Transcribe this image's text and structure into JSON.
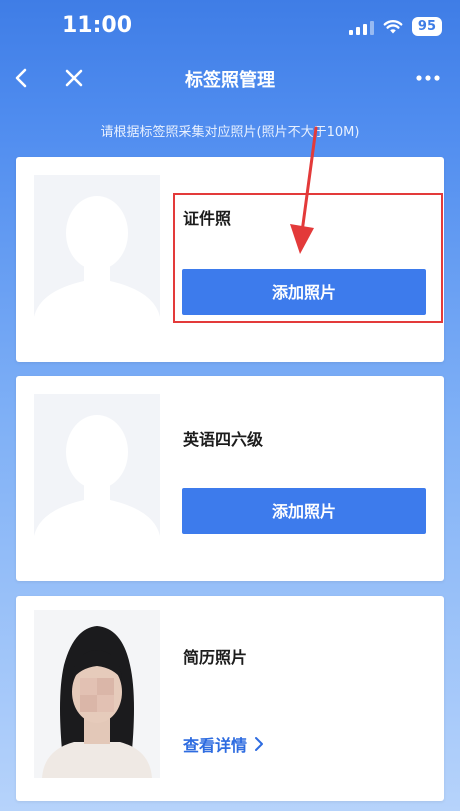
{
  "status_bar": {
    "time": "11:00",
    "battery": "95"
  },
  "nav": {
    "title": "标签照管理",
    "back_icon": "chevron-left-icon",
    "close_icon": "close-icon",
    "more_icon": "more-icon"
  },
  "notice": "请根据标签照采集对应照片(照片不大于10M)",
  "cards": [
    {
      "label": "证件照",
      "action": "添加照片",
      "photo": "placeholder-silhouette"
    },
    {
      "label": "英语四六级",
      "action": "添加照片",
      "photo": "placeholder-silhouette"
    },
    {
      "label": "简历照片",
      "action": "查看详情",
      "photo": "portrait-photo"
    }
  ],
  "colors": {
    "accent": "#3d7bec",
    "annotation": "#e33a3a",
    "header": "#3f7de6"
  }
}
